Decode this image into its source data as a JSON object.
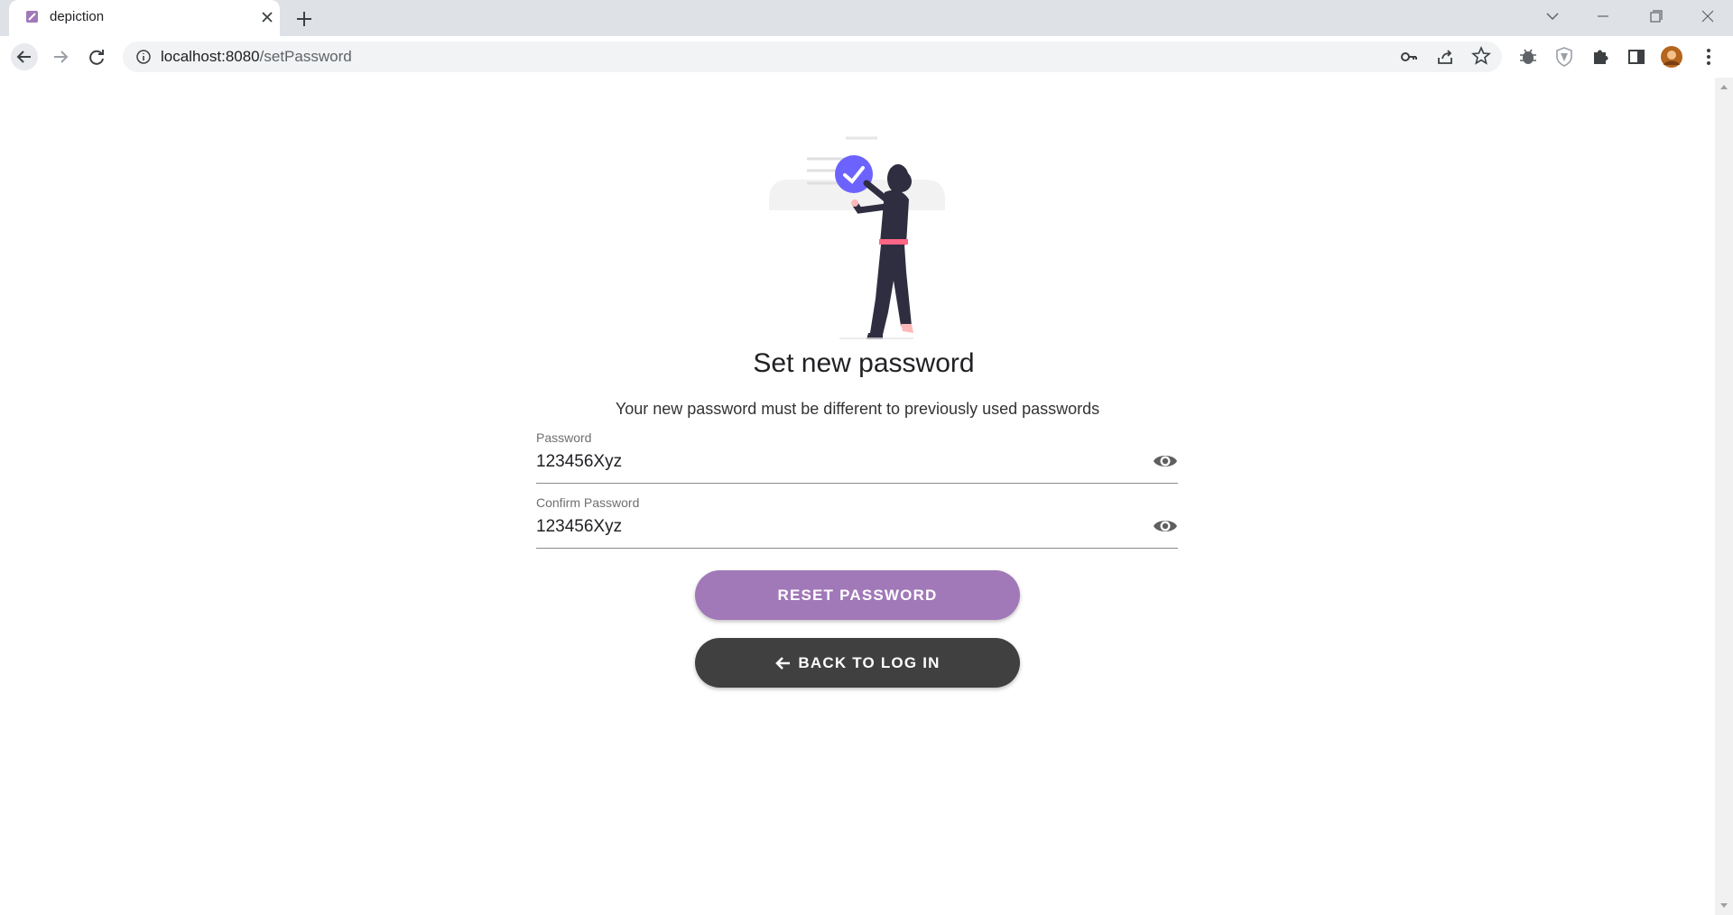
{
  "browser": {
    "tab_title": "depiction",
    "url_host": "localhost:8080",
    "url_path": "/setPassword"
  },
  "page": {
    "title": "Set new password",
    "subtitle": "Your new password must be different to previously used passwords"
  },
  "form": {
    "password": {
      "label": "Password",
      "value": "123456Xyz"
    },
    "confirm_password": {
      "label": "Confirm Password",
      "value": "123456Xyz"
    }
  },
  "buttons": {
    "reset": "RESET PASSWORD",
    "back": "BACK TO LOG IN"
  },
  "colors": {
    "accent": "#a178b8",
    "dark_button": "#404040",
    "illustration_accent": "#6c63ff"
  },
  "icons": {
    "visibility": "eye-icon",
    "back": "arrow-left-icon"
  }
}
